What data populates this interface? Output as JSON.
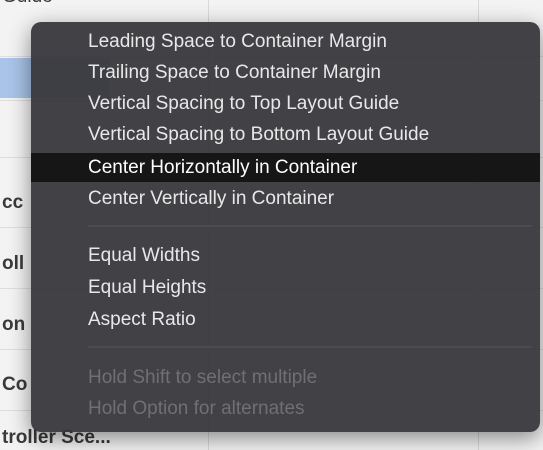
{
  "background": {
    "rows": [
      "Guide",
      "",
      "",
      "",
      "",
      "cc",
      "oll",
      "on",
      "Co",
      "troller Sce..."
    ]
  },
  "menu": {
    "groups": [
      {
        "items": [
          {
            "label": "Leading Space to Container Margin",
            "state": "normal"
          },
          {
            "label": "Trailing Space to Container Margin",
            "state": "normal"
          },
          {
            "label": "Vertical Spacing to Top Layout Guide",
            "state": "normal"
          },
          {
            "label": "Vertical Spacing to Bottom Layout Guide",
            "state": "normal"
          },
          {
            "label": "Center Horizontally in Container",
            "state": "selected"
          },
          {
            "label": "Center Vertically in Container",
            "state": "normal"
          }
        ]
      },
      {
        "items": [
          {
            "label": "Equal Widths",
            "state": "normal"
          },
          {
            "label": "Equal Heights",
            "state": "normal"
          },
          {
            "label": "Aspect Ratio",
            "state": "normal"
          }
        ]
      },
      {
        "items": [
          {
            "label": "Hold Shift to select multiple",
            "state": "disabled"
          },
          {
            "label": "Hold Option for alternates",
            "state": "disabled"
          }
        ]
      }
    ]
  },
  "colors": {
    "menu_background": "#36363a",
    "menu_text": "#e8e8e8",
    "selected_background": "#161616",
    "disabled_text": "#6f6f74"
  }
}
